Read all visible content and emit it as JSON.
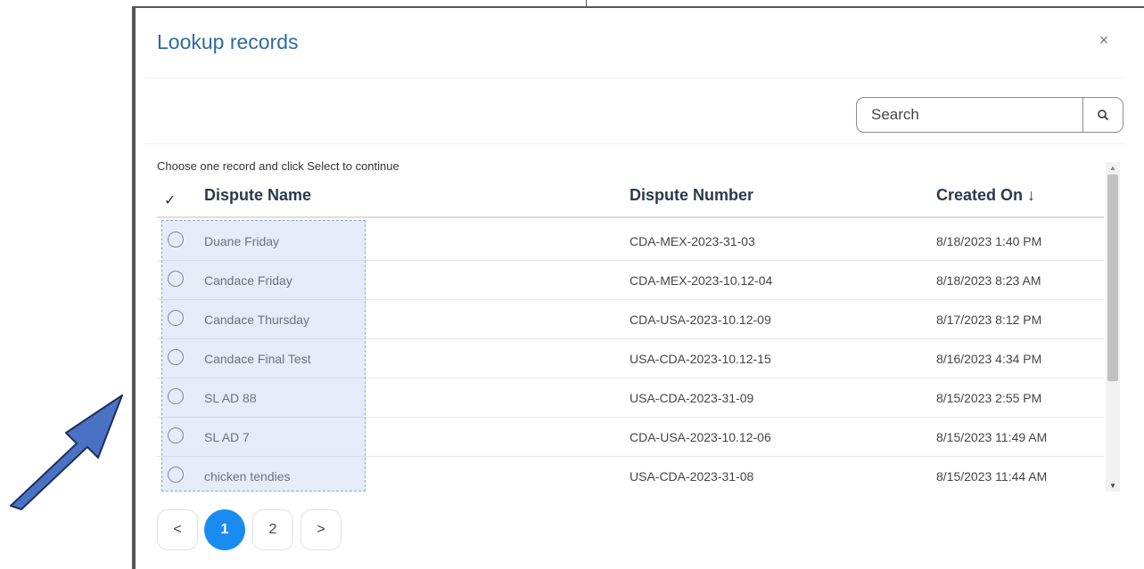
{
  "dialog": {
    "title": "Lookup records",
    "close_label": "×",
    "search_placeholder": "Search",
    "instruction": "Choose one record and click Select to continue"
  },
  "table": {
    "header_check": "✓",
    "columns": [
      "Dispute Name",
      "Dispute Number",
      "Created On ↓"
    ],
    "rows": [
      {
        "name": "Duane Friday",
        "number": "CDA-MEX-2023-31-03",
        "created": "8/18/2023 1:40 PM"
      },
      {
        "name": "Candace Friday",
        "number": "CDA-MEX-2023-10.12-04",
        "created": "8/18/2023 8:23 AM"
      },
      {
        "name": "Candace Thursday",
        "number": "CDA-USA-2023-10.12-09",
        "created": "8/17/2023 8:12 PM"
      },
      {
        "name": "Candace Final Test",
        "number": "USA-CDA-2023-10.12-15",
        "created": "8/16/2023 4:34 PM"
      },
      {
        "name": "SL AD 88",
        "number": "USA-CDA-2023-31-09",
        "created": "8/15/2023 2:55 PM"
      },
      {
        "name": "SL AD 7",
        "number": "CDA-USA-2023-10.12-06",
        "created": "8/15/2023 11:49 AM"
      },
      {
        "name": "chicken tendies",
        "number": "USA-CDA-2023-31-08",
        "created": "8/15/2023 11:44 AM"
      }
    ]
  },
  "pagination": {
    "prev": "<",
    "pages": [
      "1",
      "2"
    ],
    "current": "1",
    "next": ">"
  },
  "colors": {
    "title": "#2e6a9e",
    "accent": "#1a8cf0",
    "highlight": "#b4c8eb",
    "arrow": "#4a72c4"
  }
}
